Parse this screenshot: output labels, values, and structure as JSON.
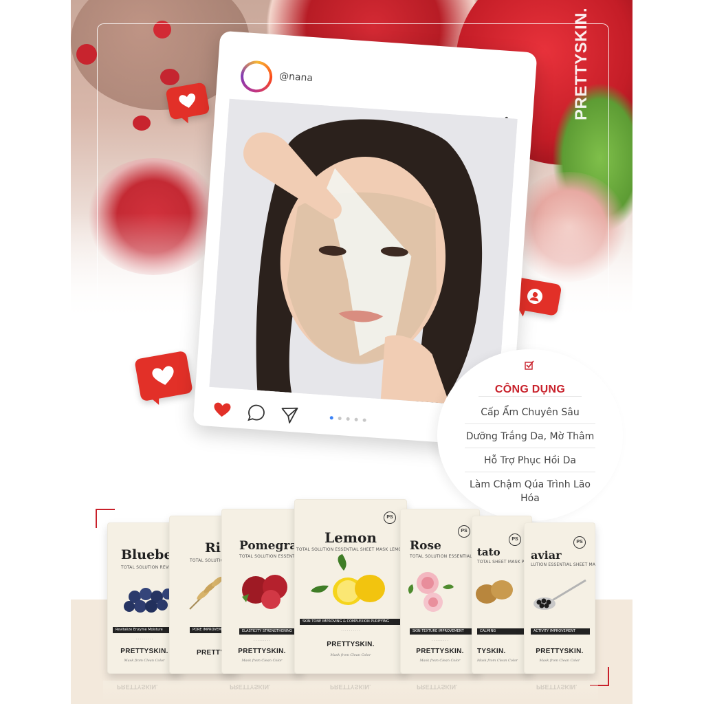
{
  "post": {
    "username": "@nana",
    "carousel": {
      "count": 5,
      "active": 0
    }
  },
  "brand": {
    "vertical_logo": "PRETTYSKIN."
  },
  "benefits": {
    "title": "CÔNG DỤNG",
    "items": [
      "Cấp Ẩm Chuyên Sâu",
      "Dưỡng Trắng Da, Mờ Thâm",
      "Hỗ Trợ Phục Hồi Da",
      "Làm Chậm Qúa Trình Lão Hóa"
    ]
  },
  "products": [
    {
      "id": "blueberry",
      "name": "Blueber",
      "subtitle": "TOTAL SOLUTION REVITALIZE SHEET MA",
      "band": "Revitalize Enzyme Moisture",
      "brand": "PRETTYSKIN.",
      "tagline": "Mask from Clean Color"
    },
    {
      "id": "rice",
      "name": "Ri",
      "subtitle": "TOTAL SOLUTION PERFECT",
      "band": "PORE IMPROVEMENT & CO",
      "brand": "PRETTYSKIN",
      "tagline": ""
    },
    {
      "id": "pomegranate",
      "name": "Pomegran",
      "subtitle": "TOTAL SOLUTION ESSENTIAL SHEET MASK P",
      "band": "ELASTICITY STRENGTHENING",
      "brand": "PRETTYSKIN.",
      "tagline": "Mask from Clean Color"
    },
    {
      "id": "lemon",
      "name": "Lemon",
      "subtitle": "TOTAL SOLUTION ESSENTIAL SHEET MASK LEMON",
      "band": "SKIN TONE IMPROVING & COMPLEXION PURIFYING",
      "brand": "PRETTYSKIN.",
      "tagline": "Mask from Clean Color",
      "ps": "PS"
    },
    {
      "id": "rose",
      "name": "Rose",
      "subtitle": "TOTAL SOLUTION ESSENTIAL SHEET MASK ROSE",
      "band": "SKIN TEXTURE IMPROVEMENT",
      "brand": "PRETTYSKIN.",
      "tagline": "Mask from Clean Color",
      "ps": "PS"
    },
    {
      "id": "potato",
      "name": "tato",
      "subtitle": "TOTAL SHEET MASK POTATO",
      "band": "CALMING",
      "brand": "TYSKIN.",
      "tagline": "Mask from Clean Color",
      "ps": "PS"
    },
    {
      "id": "caviar",
      "name": "aviar",
      "subtitle": "LUTION ESSENTIAL SHEET MASK CAVIAR",
      "band": "ACTIVITY IMPROVEMENT",
      "brand": "PRETTYSKIN.",
      "tagline": "Mask from Clean Color",
      "ps": "PS"
    }
  ],
  "colors": {
    "accent_red": "#c8202a",
    "badge_red": "#e23028",
    "pack_cream": "#f5f0e4",
    "beige_floor": "#f3e9dc"
  },
  "icons": {
    "post_more": "more-vertical-icon",
    "like": "heart-icon",
    "comment": "comment-icon",
    "share": "send-icon",
    "badge_like": "heart-icon",
    "badge_follow": "user-icon",
    "benefit_check": "checkbox-icon"
  }
}
